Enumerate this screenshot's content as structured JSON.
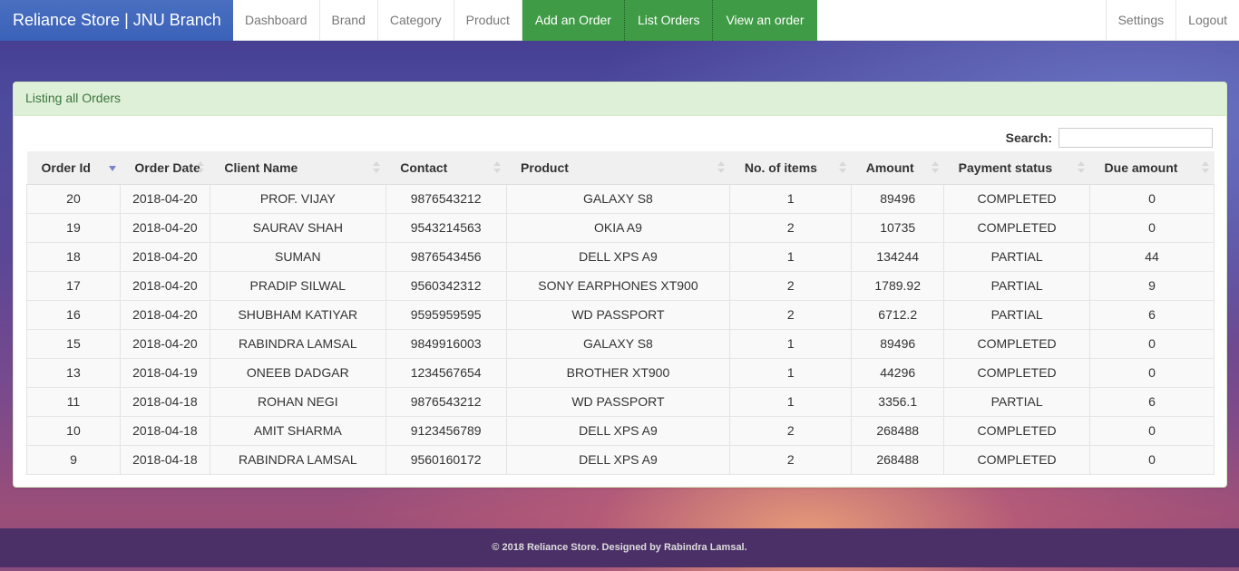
{
  "navbar": {
    "brand": "Reliance Store | JNU Branch",
    "items": [
      "Dashboard",
      "Brand",
      "Category",
      "Product"
    ],
    "actions": [
      "Add an Order",
      "List Orders",
      "View an order"
    ],
    "right_items": [
      "Settings",
      "Logout"
    ],
    "accent_color": "#3f9b45",
    "brand_color": "#3a62b8"
  },
  "panel": {
    "heading": "Listing all Orders",
    "search_label": "Search:",
    "search_value": ""
  },
  "table": {
    "columns": [
      "Order Id",
      "Order Date",
      "Client Name",
      "Contact",
      "Product",
      "No. of items",
      "Amount",
      "Payment status",
      "Due amount"
    ],
    "rows": [
      [
        "20",
        "2018-04-20",
        "PROF. VIJAY",
        "9876543212",
        "GALAXY S8",
        "1",
        "89496",
        "COMPLETED",
        "0"
      ],
      [
        "19",
        "2018-04-20",
        "SAURAV SHAH",
        "9543214563",
        "OKIA A9",
        "2",
        "10735",
        "COMPLETED",
        "0"
      ],
      [
        "18",
        "2018-04-20",
        "SUMAN",
        "9876543456",
        "DELL XPS A9",
        "1",
        "134244",
        "PARTIAL",
        "44"
      ],
      [
        "17",
        "2018-04-20",
        "PRADIP SILWAL",
        "9560342312",
        "SONY EARPHONES XT900",
        "2",
        "1789.92",
        "PARTIAL",
        "9"
      ],
      [
        "16",
        "2018-04-20",
        "SHUBHAM KATIYAR",
        "9595959595",
        "WD PASSPORT",
        "2",
        "6712.2",
        "PARTIAL",
        "6"
      ],
      [
        "15",
        "2018-04-20",
        "RABINDRA LAMSAL",
        "9849916003",
        "GALAXY S8",
        "1",
        "89496",
        "COMPLETED",
        "0"
      ],
      [
        "13",
        "2018-04-19",
        "ONEEB DADGAR",
        "1234567654",
        "BROTHER XT900",
        "1",
        "44296",
        "COMPLETED",
        "0"
      ],
      [
        "11",
        "2018-04-18",
        "ROHAN NEGI",
        "9876543212",
        "WD PASSPORT",
        "1",
        "3356.1",
        "PARTIAL",
        "6"
      ],
      [
        "10",
        "2018-04-18",
        "AMIT SHARMA",
        "9123456789",
        "DELL XPS A9",
        "2",
        "268488",
        "COMPLETED",
        "0"
      ],
      [
        "9",
        "2018-04-18",
        "RABINDRA LAMSAL",
        "9560160172",
        "DELL XPS A9",
        "2",
        "268488",
        "COMPLETED",
        "0"
      ]
    ]
  },
  "footer": {
    "text": "© 2018 Reliance Store. Designed by Rabindra Lamsal."
  }
}
